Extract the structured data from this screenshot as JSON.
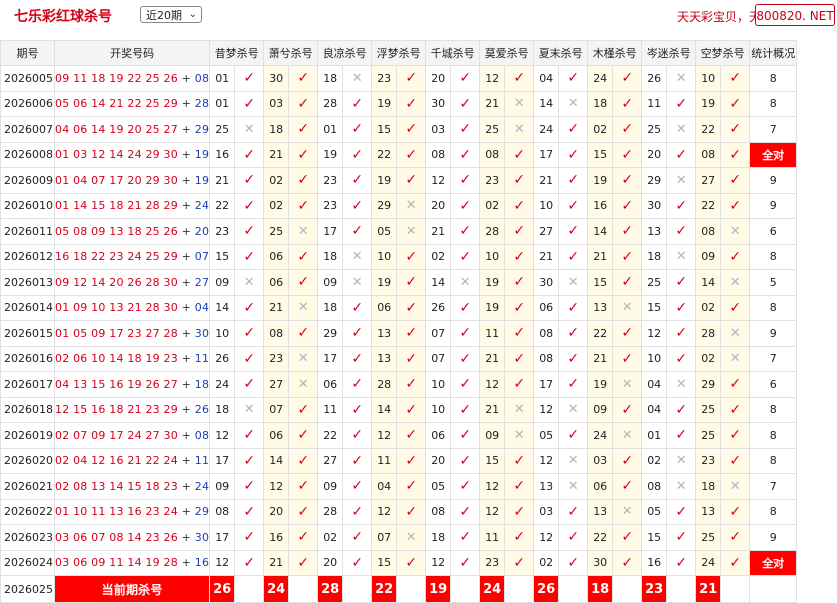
{
  "header": {
    "title": "七乐彩红球杀号",
    "period_select": "近20期",
    "ad_text": "天天彩宝贝，天",
    "site_badge": "800820. NET"
  },
  "columns": {
    "period": "期号",
    "draw": "开奖号码",
    "experts": [
      "昔梦杀号",
      "萧兮杀号",
      "良凉杀号",
      "浮梦杀号",
      "千城杀号",
      "莫爱杀号",
      "夏末杀号",
      "木槿杀号",
      "岑迷杀号",
      "空梦杀号"
    ],
    "stat": "统计概况"
  },
  "rows": [
    {
      "period": "2026005",
      "main": "09 11 18 19 22 25 26",
      "special": "08",
      "picks": [
        {
          "n": "01",
          "ok": true
        },
        {
          "n": "30",
          "ok": true
        },
        {
          "n": "18",
          "ok": false
        },
        {
          "n": "23",
          "ok": true
        },
        {
          "n": "20",
          "ok": true
        },
        {
          "n": "12",
          "ok": true
        },
        {
          "n": "04",
          "ok": true
        },
        {
          "n": "24",
          "ok": true
        },
        {
          "n": "26",
          "ok": false
        },
        {
          "n": "10",
          "ok": true
        }
      ],
      "stat": "8"
    },
    {
      "period": "2026006",
      "main": "05 06 14 21 22 25 29",
      "special": "28",
      "picks": [
        {
          "n": "01",
          "ok": true
        },
        {
          "n": "03",
          "ok": true
        },
        {
          "n": "28",
          "ok": true
        },
        {
          "n": "19",
          "ok": true
        },
        {
          "n": "30",
          "ok": true
        },
        {
          "n": "21",
          "ok": false
        },
        {
          "n": "14",
          "ok": false
        },
        {
          "n": "18",
          "ok": true
        },
        {
          "n": "11",
          "ok": true
        },
        {
          "n": "19",
          "ok": true
        }
      ],
      "stat": "8"
    },
    {
      "period": "2026007",
      "main": "04 06 14 19 20 25 27",
      "special": "29",
      "picks": [
        {
          "n": "25",
          "ok": false
        },
        {
          "n": "18",
          "ok": true
        },
        {
          "n": "01",
          "ok": true
        },
        {
          "n": "15",
          "ok": true
        },
        {
          "n": "03",
          "ok": true
        },
        {
          "n": "25",
          "ok": false
        },
        {
          "n": "24",
          "ok": true
        },
        {
          "n": "02",
          "ok": true
        },
        {
          "n": "25",
          "ok": false
        },
        {
          "n": "22",
          "ok": true
        }
      ],
      "stat": "7"
    },
    {
      "period": "2026008",
      "main": "01 03 12 14 24 29 30",
      "special": "19",
      "picks": [
        {
          "n": "16",
          "ok": true
        },
        {
          "n": "21",
          "ok": true
        },
        {
          "n": "19",
          "ok": true
        },
        {
          "n": "22",
          "ok": true
        },
        {
          "n": "08",
          "ok": true
        },
        {
          "n": "08",
          "ok": true
        },
        {
          "n": "17",
          "ok": true
        },
        {
          "n": "15",
          "ok": true
        },
        {
          "n": "20",
          "ok": true
        },
        {
          "n": "08",
          "ok": true
        }
      ],
      "stat": "全对"
    },
    {
      "period": "2026009",
      "main": "01 04 07 17 20 29 30",
      "special": "19",
      "picks": [
        {
          "n": "21",
          "ok": true
        },
        {
          "n": "02",
          "ok": true
        },
        {
          "n": "23",
          "ok": true
        },
        {
          "n": "19",
          "ok": true
        },
        {
          "n": "12",
          "ok": true
        },
        {
          "n": "23",
          "ok": true
        },
        {
          "n": "21",
          "ok": true
        },
        {
          "n": "19",
          "ok": true
        },
        {
          "n": "29",
          "ok": false
        },
        {
          "n": "27",
          "ok": true
        }
      ],
      "stat": "9"
    },
    {
      "period": "2026010",
      "main": "01 14 15 18 21 28 29",
      "special": "24",
      "picks": [
        {
          "n": "22",
          "ok": true
        },
        {
          "n": "02",
          "ok": true
        },
        {
          "n": "23",
          "ok": true
        },
        {
          "n": "29",
          "ok": false
        },
        {
          "n": "20",
          "ok": true
        },
        {
          "n": "02",
          "ok": true
        },
        {
          "n": "10",
          "ok": true
        },
        {
          "n": "16",
          "ok": true
        },
        {
          "n": "30",
          "ok": true
        },
        {
          "n": "22",
          "ok": true
        }
      ],
      "stat": "9"
    },
    {
      "period": "2026011",
      "main": "05 08 09 13 18 25 26",
      "special": "20",
      "picks": [
        {
          "n": "23",
          "ok": true
        },
        {
          "n": "25",
          "ok": false
        },
        {
          "n": "17",
          "ok": true
        },
        {
          "n": "05",
          "ok": false
        },
        {
          "n": "21",
          "ok": true
        },
        {
          "n": "28",
          "ok": true
        },
        {
          "n": "27",
          "ok": true
        },
        {
          "n": "14",
          "ok": true
        },
        {
          "n": "13",
          "ok": true
        },
        {
          "n": "08",
          "ok": false
        }
      ],
      "stat": "6"
    },
    {
      "period": "2026012",
      "main": "16 18 22 23 24 25 29",
      "special": "07",
      "picks": [
        {
          "n": "15",
          "ok": true
        },
        {
          "n": "06",
          "ok": true
        },
        {
          "n": "18",
          "ok": false
        },
        {
          "n": "10",
          "ok": true
        },
        {
          "n": "02",
          "ok": true
        },
        {
          "n": "10",
          "ok": true
        },
        {
          "n": "21",
          "ok": true
        },
        {
          "n": "21",
          "ok": true
        },
        {
          "n": "18",
          "ok": false
        },
        {
          "n": "09",
          "ok": true
        }
      ],
      "stat": "8"
    },
    {
      "period": "2026013",
      "main": "09 12 14 20 26 28 30",
      "special": "27",
      "picks": [
        {
          "n": "09",
          "ok": false
        },
        {
          "n": "06",
          "ok": true
        },
        {
          "n": "09",
          "ok": false
        },
        {
          "n": "19",
          "ok": true
        },
        {
          "n": "14",
          "ok": false
        },
        {
          "n": "19",
          "ok": true
        },
        {
          "n": "30",
          "ok": false
        },
        {
          "n": "15",
          "ok": true
        },
        {
          "n": "25",
          "ok": true
        },
        {
          "n": "14",
          "ok": false
        }
      ],
      "stat": "5"
    },
    {
      "period": "2026014",
      "main": "01 09 10 13 21 28 30",
      "special": "04",
      "picks": [
        {
          "n": "14",
          "ok": true
        },
        {
          "n": "21",
          "ok": false
        },
        {
          "n": "18",
          "ok": true
        },
        {
          "n": "06",
          "ok": true
        },
        {
          "n": "26",
          "ok": true
        },
        {
          "n": "19",
          "ok": true
        },
        {
          "n": "06",
          "ok": true
        },
        {
          "n": "13",
          "ok": false
        },
        {
          "n": "15",
          "ok": true
        },
        {
          "n": "02",
          "ok": true
        }
      ],
      "stat": "8"
    },
    {
      "period": "2026015",
      "main": "01 05 09 17 23 27 28",
      "special": "30",
      "picks": [
        {
          "n": "10",
          "ok": true
        },
        {
          "n": "08",
          "ok": true
        },
        {
          "n": "29",
          "ok": true
        },
        {
          "n": "13",
          "ok": true
        },
        {
          "n": "07",
          "ok": true
        },
        {
          "n": "11",
          "ok": true
        },
        {
          "n": "08",
          "ok": true
        },
        {
          "n": "22",
          "ok": true
        },
        {
          "n": "12",
          "ok": true
        },
        {
          "n": "28",
          "ok": false
        }
      ],
      "stat": "9"
    },
    {
      "period": "2026016",
      "main": "02 06 10 14 18 19 23",
      "special": "11",
      "picks": [
        {
          "n": "26",
          "ok": true
        },
        {
          "n": "23",
          "ok": false
        },
        {
          "n": "17",
          "ok": true
        },
        {
          "n": "13",
          "ok": true
        },
        {
          "n": "07",
          "ok": true
        },
        {
          "n": "21",
          "ok": true
        },
        {
          "n": "08",
          "ok": true
        },
        {
          "n": "21",
          "ok": true
        },
        {
          "n": "10",
          "ok": true
        },
        {
          "n": "02",
          "ok": false
        }
      ],
      "stat": "7"
    },
    {
      "period": "2026017",
      "main": "04 13 15 16 19 26 27",
      "special": "18",
      "picks": [
        {
          "n": "24",
          "ok": true
        },
        {
          "n": "27",
          "ok": false
        },
        {
          "n": "06",
          "ok": true
        },
        {
          "n": "28",
          "ok": true
        },
        {
          "n": "10",
          "ok": true
        },
        {
          "n": "12",
          "ok": true
        },
        {
          "n": "17",
          "ok": true
        },
        {
          "n": "19",
          "ok": false
        },
        {
          "n": "04",
          "ok": false
        },
        {
          "n": "29",
          "ok": true
        }
      ],
      "stat": "6"
    },
    {
      "period": "2026018",
      "main": "12 15 16 18 21 23 29",
      "special": "26",
      "picks": [
        {
          "n": "18",
          "ok": false
        },
        {
          "n": "07",
          "ok": true
        },
        {
          "n": "11",
          "ok": true
        },
        {
          "n": "14",
          "ok": true
        },
        {
          "n": "10",
          "ok": true
        },
        {
          "n": "21",
          "ok": false
        },
        {
          "n": "12",
          "ok": false
        },
        {
          "n": "09",
          "ok": true
        },
        {
          "n": "04",
          "ok": true
        },
        {
          "n": "25",
          "ok": true
        }
      ],
      "stat": "8"
    },
    {
      "period": "2026019",
      "main": "02 07 09 17 24 27 30",
      "special": "08",
      "picks": [
        {
          "n": "12",
          "ok": true
        },
        {
          "n": "06",
          "ok": true
        },
        {
          "n": "22",
          "ok": true
        },
        {
          "n": "12",
          "ok": true
        },
        {
          "n": "06",
          "ok": true
        },
        {
          "n": "09",
          "ok": false
        },
        {
          "n": "05",
          "ok": true
        },
        {
          "n": "24",
          "ok": false
        },
        {
          "n": "01",
          "ok": true
        },
        {
          "n": "25",
          "ok": true
        }
      ],
      "stat": "8"
    },
    {
      "period": "2026020",
      "main": "02 04 12 16 21 22 24",
      "special": "11",
      "picks": [
        {
          "n": "17",
          "ok": true
        },
        {
          "n": "14",
          "ok": true
        },
        {
          "n": "27",
          "ok": true
        },
        {
          "n": "11",
          "ok": true
        },
        {
          "n": "20",
          "ok": true
        },
        {
          "n": "15",
          "ok": true
        },
        {
          "n": "12",
          "ok": false
        },
        {
          "n": "03",
          "ok": true
        },
        {
          "n": "02",
          "ok": false
        },
        {
          "n": "23",
          "ok": true
        }
      ],
      "stat": "8"
    },
    {
      "period": "2026021",
      "main": "02 08 13 14 15 18 23",
      "special": "24",
      "picks": [
        {
          "n": "09",
          "ok": true
        },
        {
          "n": "12",
          "ok": true
        },
        {
          "n": "09",
          "ok": true
        },
        {
          "n": "04",
          "ok": true
        },
        {
          "n": "05",
          "ok": true
        },
        {
          "n": "12",
          "ok": true
        },
        {
          "n": "13",
          "ok": false
        },
        {
          "n": "06",
          "ok": true
        },
        {
          "n": "08",
          "ok": false
        },
        {
          "n": "18",
          "ok": false
        }
      ],
      "stat": "7"
    },
    {
      "period": "2026022",
      "main": "01 10 11 13 16 23 24",
      "special": "29",
      "picks": [
        {
          "n": "08",
          "ok": true
        },
        {
          "n": "20",
          "ok": true
        },
        {
          "n": "28",
          "ok": true
        },
        {
          "n": "12",
          "ok": true
        },
        {
          "n": "08",
          "ok": true
        },
        {
          "n": "12",
          "ok": true
        },
        {
          "n": "03",
          "ok": true
        },
        {
          "n": "13",
          "ok": false
        },
        {
          "n": "05",
          "ok": true
        },
        {
          "n": "13",
          "ok": true
        }
      ],
      "stat": "8"
    },
    {
      "period": "2026023",
      "main": "03 06 07 08 14 23 26",
      "special": "30",
      "picks": [
        {
          "n": "17",
          "ok": true
        },
        {
          "n": "16",
          "ok": true
        },
        {
          "n": "02",
          "ok": true
        },
        {
          "n": "07",
          "ok": false
        },
        {
          "n": "18",
          "ok": true
        },
        {
          "n": "11",
          "ok": true
        },
        {
          "n": "12",
          "ok": true
        },
        {
          "n": "22",
          "ok": true
        },
        {
          "n": "15",
          "ok": true
        },
        {
          "n": "25",
          "ok": true
        }
      ],
      "stat": "9"
    },
    {
      "period": "2026024",
      "main": "03 06 09 11 14 19 28",
      "special": "16",
      "picks": [
        {
          "n": "12",
          "ok": true
        },
        {
          "n": "21",
          "ok": true
        },
        {
          "n": "20",
          "ok": true
        },
        {
          "n": "15",
          "ok": true
        },
        {
          "n": "12",
          "ok": true
        },
        {
          "n": "23",
          "ok": true
        },
        {
          "n": "02",
          "ok": true
        },
        {
          "n": "30",
          "ok": true
        },
        {
          "n": "16",
          "ok": true
        },
        {
          "n": "24",
          "ok": true
        }
      ],
      "stat": "全对"
    }
  ],
  "current": {
    "period": "2026025",
    "label": "当前期杀号",
    "picks": [
      "26",
      "24",
      "28",
      "22",
      "19",
      "24",
      "26",
      "18",
      "23",
      "21"
    ]
  },
  "marks": {
    "ok": "✓",
    "no": "✕"
  }
}
